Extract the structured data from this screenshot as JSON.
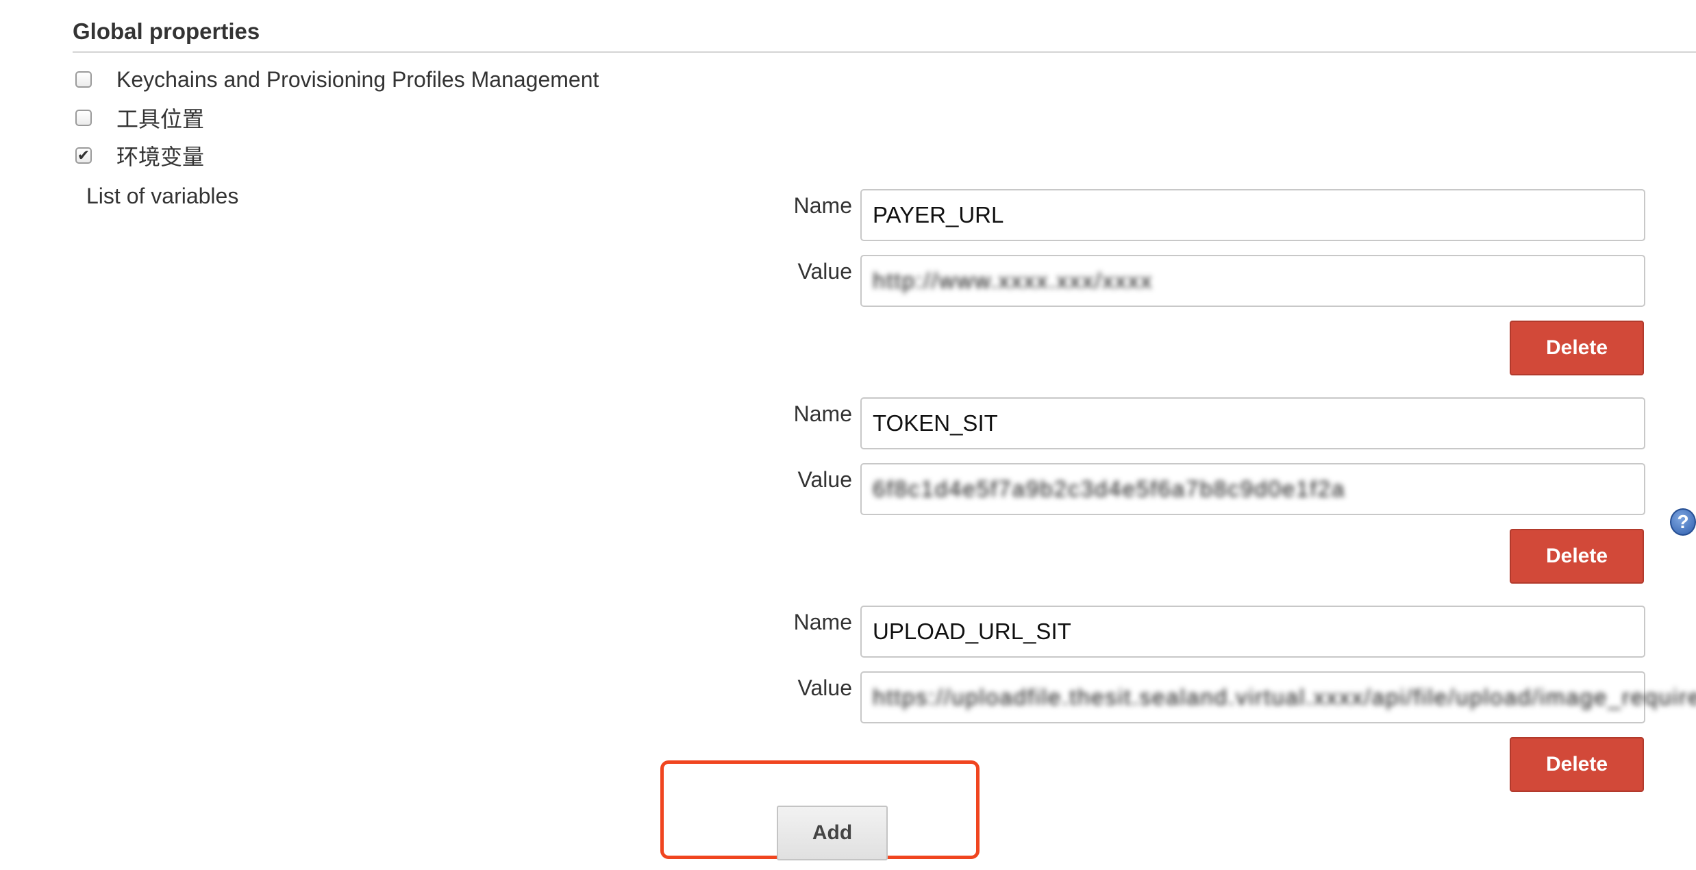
{
  "section": {
    "title": "Global properties"
  },
  "checkboxes": [
    {
      "label": "Keychains and Provisioning Profiles Management",
      "checked": false
    },
    {
      "label": "工具位置",
      "checked": false
    },
    {
      "label": "环境变量",
      "checked": true
    }
  ],
  "checkmark_glyph": "✔",
  "env": {
    "list_label": "List of variables",
    "name_label": "Name",
    "value_label": "Value",
    "delete_label": "Delete",
    "variables": [
      {
        "name": "PAYER_URL",
        "value": "http://www.xxxx.xxx/xxxx"
      },
      {
        "name": "TOKEN_SIT",
        "value": "6f8c1d4e5f7a9b2c3d4e5f6a7b8c9d0e1f2a"
      },
      {
        "name": "UPLOAD_URL_SIT",
        "value": "https://uploadfile.thesit.sealand.virtual.xxxx/api/file/upload/image_required"
      }
    ]
  },
  "add_button": {
    "label": "Add"
  },
  "help_icon_glyph": "?",
  "colors": {
    "delete_button": "#d24939",
    "highlight": "#f0451f",
    "help_icon": "#2f5fae"
  }
}
